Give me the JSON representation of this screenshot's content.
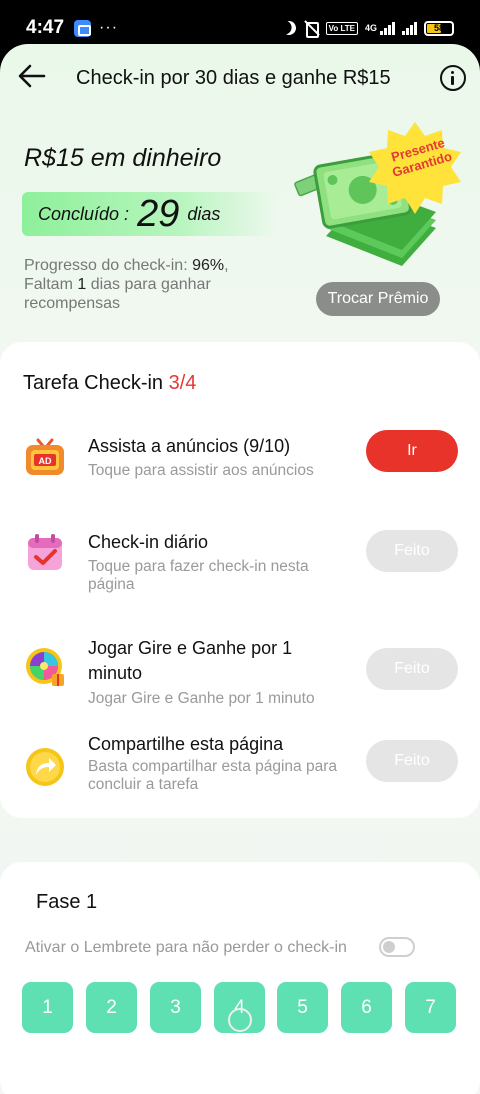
{
  "status_bar": {
    "time": "4:47",
    "more": "···",
    "network": "4G",
    "volte": "Vo LTE",
    "battery": "58"
  },
  "header": {
    "title": "Check-in por 30 dias e ganhe R$15"
  },
  "reward": {
    "title": "R$15 em dinheiro",
    "done_label": "Concluído :",
    "done_days": "29",
    "done_unit": "dias",
    "progress_label": "Progresso do check-in: ",
    "progress_value": "96%",
    "progress_suffix": ",",
    "remaining_prefix": "Faltam ",
    "remaining_value": "1",
    "remaining_suffix": " dias para ganhar recompensas",
    "badge_text": "Presente Garantido",
    "trade_button": "Trocar Prêmio"
  },
  "tasks": {
    "title": "Tarefa Check-in ",
    "count": "3/4",
    "items": [
      {
        "title": "Assista a anúncios  (9/10)",
        "subtitle": "Toque para assistir aos anúncios",
        "button": "Ir",
        "icon": "ad-tv-icon",
        "state": "pending"
      },
      {
        "title": "Check-in diário",
        "subtitle": "Toque para fazer check-in nesta página",
        "button": "Feito",
        "icon": "calendar-check-icon",
        "state": "done"
      },
      {
        "title": "Jogar Gire e Ganhe por 1 minuto",
        "subtitle": "Jogar Gire e Ganhe por 1 minuto",
        "button": "Feito",
        "icon": "prize-wheel-icon",
        "state": "done"
      },
      {
        "title": "Compartilhe esta página",
        "subtitle": "Basta compartilhar esta página para concluir a tarefa",
        "button": "Feito",
        "icon": "share-arrow-icon",
        "state": "done"
      }
    ]
  },
  "phase": {
    "title": "Fase 1",
    "reminder": "Ativar o Lembrete para não perder o check-in",
    "reminder_enabled": false,
    "days": [
      "1",
      "2",
      "3",
      "4",
      "5",
      "6",
      "7"
    ]
  },
  "colors": {
    "accent_red": "#e8332a",
    "day_green": "#5fe0b3",
    "done_gray": "#e5e5e5"
  }
}
